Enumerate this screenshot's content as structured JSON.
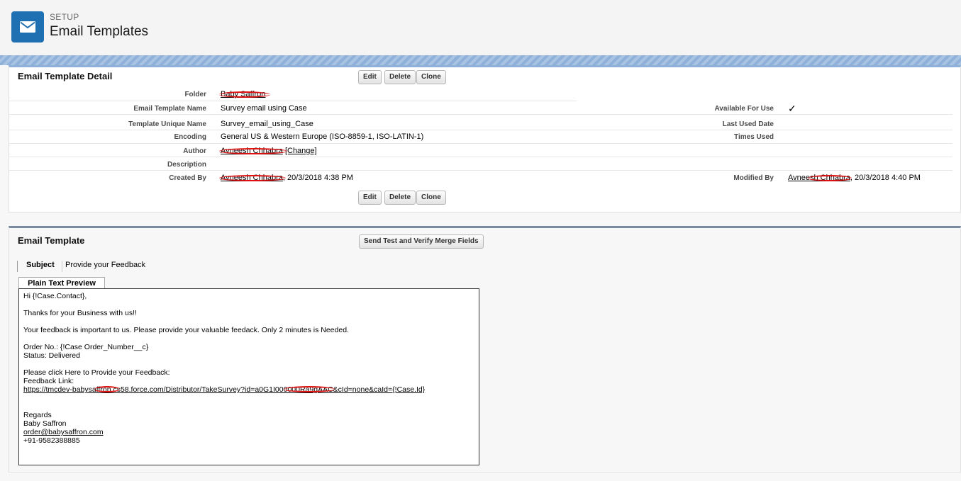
{
  "header": {
    "setup_label": "SETUP",
    "title": "Email Templates",
    "icon": "envelope-icon",
    "accent_color": "#1f6fb3"
  },
  "detail": {
    "title": "Email Template Detail",
    "buttons": {
      "edit": "Edit",
      "delete": "Delete",
      "clone": "Clone"
    },
    "fields": {
      "folder": {
        "label": "Folder",
        "value": "Baby Saffron"
      },
      "name": {
        "label": "Email Template Name",
        "value": "Survey email using Case"
      },
      "unique_name": {
        "label": "Template Unique Name",
        "value": "Survey_email_using_Case"
      },
      "encoding": {
        "label": "Encoding",
        "value": "General US & Western Europe (ISO-8859-1, ISO-LATIN-1)"
      },
      "author": {
        "label": "Author",
        "value": "Avneesh Chhabra",
        "change_link": "[Change]"
      },
      "description": {
        "label": "Description",
        "value": ""
      },
      "created_by": {
        "label": "Created By",
        "user": "Avneesh Chhabra",
        "date": ", 20/3/2018 4:38 PM"
      },
      "available": {
        "label": "Available For Use",
        "checked": true
      },
      "last_used": {
        "label": "Last Used Date",
        "value": ""
      },
      "times_used": {
        "label": "Times Used",
        "value": ""
      },
      "modified_by": {
        "label": "Modified By",
        "user": "Avneesh Chhabra",
        "date": ", 20/3/2018 4:40 PM"
      }
    }
  },
  "email": {
    "title": "Email Template",
    "send_test_button": "Send Test and Verify Merge Fields",
    "subject_label": "Subject",
    "subject_value": "Provide your Feedback",
    "tab_label": "Plain Text Preview",
    "body": {
      "greeting": "Hi {!Case.Contact},",
      "thanks": "Thanks for your Business with us!!",
      "feedback_note": "Your feedback is important to us. Please provide your valuable feedack. Only 2 minutes is Needed.",
      "order_no": "Order No.: {!Case Order_Number__c}",
      "status": "Status: Delivered",
      "click_here": "Please click Here to Provide your Feedback:",
      "feedback_link_label": "Feedback Link:",
      "feedback_url": "https://tmcdev-babysaffron.cs58.force.com/Distributor/TakeSurvey?id=a0G1I000000Ra9gAAC&cId=none&caId={!Case.Id}",
      "regards": "Regards",
      "sender": "Baby Saffron",
      "email": "order@babysaffron.com",
      "phone": "+91-9582388885"
    }
  }
}
